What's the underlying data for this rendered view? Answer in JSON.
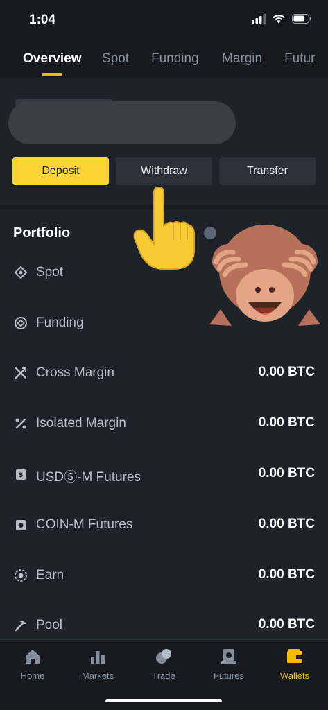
{
  "status_bar": {
    "time": "1:04"
  },
  "tabs": [
    {
      "label": "Overview",
      "active": true
    },
    {
      "label": "Spot"
    },
    {
      "label": "Funding"
    },
    {
      "label": "Margin"
    },
    {
      "label": "Futur"
    }
  ],
  "actions": {
    "deposit": "Deposit",
    "withdraw": "Withdraw",
    "transfer": "Transfer"
  },
  "portfolio": {
    "title": "Portfolio",
    "rows": [
      {
        "label": "Spot",
        "value": "",
        "icon": "spot-icon"
      },
      {
        "label": "Funding",
        "value": "",
        "icon": "funding-icon"
      },
      {
        "label": "Cross Margin",
        "value": "0.00 BTC",
        "icon": "cross-margin-icon"
      },
      {
        "label": "Isolated Margin",
        "value": "0.00 BTC",
        "icon": "isolated-margin-icon"
      },
      {
        "label": "USDⓈ-M Futures",
        "value": "0.00 BTC",
        "icon": "usd-m-futures-icon"
      },
      {
        "label": "COIN-M Futures",
        "value": "0.00 BTC",
        "icon": "coin-m-futures-icon"
      },
      {
        "label": "Earn",
        "value": "0.00 BTC",
        "icon": "earn-icon"
      },
      {
        "label": "Pool",
        "value": "0.00 BTC",
        "icon": "pool-icon"
      }
    ]
  },
  "nav": [
    {
      "label": "Home",
      "icon": "home-icon"
    },
    {
      "label": "Markets",
      "icon": "markets-icon"
    },
    {
      "label": "Trade",
      "icon": "trade-icon"
    },
    {
      "label": "Futures",
      "icon": "futures-icon"
    },
    {
      "label": "Wallets",
      "icon": "wallet-icon",
      "active": true
    }
  ],
  "colors": {
    "accent": "#fcd535",
    "background": "#1e2329",
    "muted": "#848e9c"
  }
}
